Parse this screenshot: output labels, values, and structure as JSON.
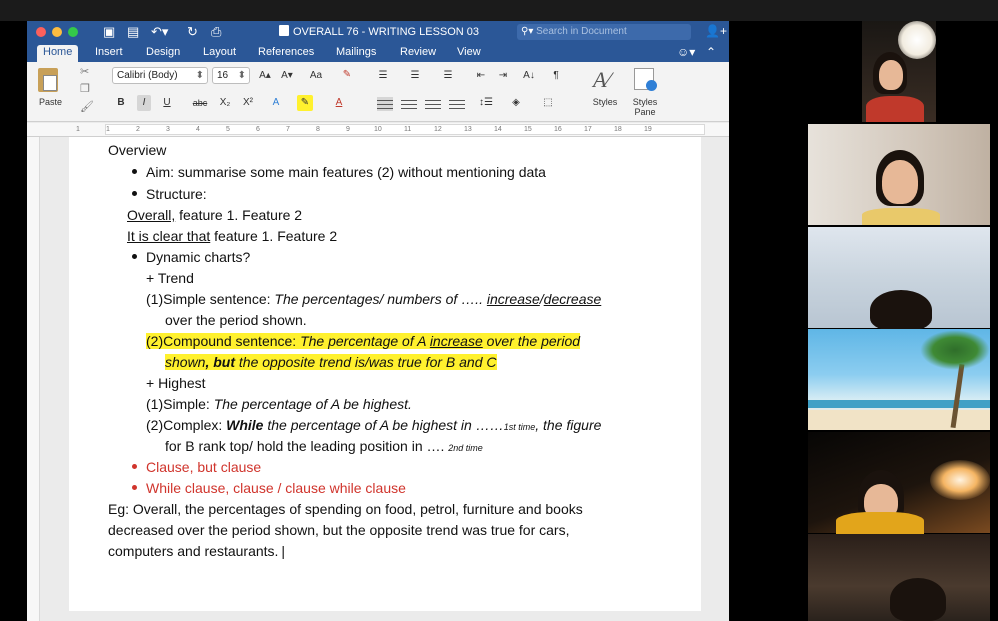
{
  "window": {
    "title": "OVERALL 76 - WRITING LESSON 03",
    "search_placeholder": "Search in Document"
  },
  "tabs": [
    {
      "label": "Home"
    },
    {
      "label": "Insert"
    },
    {
      "label": "Design"
    },
    {
      "label": "Layout"
    },
    {
      "label": "References"
    },
    {
      "label": "Mailings"
    },
    {
      "label": "Review"
    },
    {
      "label": "View"
    }
  ],
  "ribbon": {
    "paste_label": "Paste",
    "font_name": "Calibri (Body)",
    "font_size": "16",
    "bold": "B",
    "italic": "I",
    "underline": "U",
    "strikethrough": "abc",
    "subscript": "X₂",
    "superscript": "X²",
    "grow_font": "A▴",
    "shrink_font": "A▾",
    "change_case": "Aa",
    "font_color": "A",
    "highlight": "✎",
    "effects": "A",
    "sort": "A↓",
    "pilcrow": "¶",
    "styles_label": "Styles",
    "styles_pane_label": "Styles Pane"
  },
  "ruler": {
    "numbers": [
      "1",
      "1",
      "2",
      "3",
      "4",
      "5",
      "6",
      "7",
      "8",
      "9",
      "10",
      "11",
      "12",
      "13",
      "14",
      "15",
      "16",
      "17",
      "18",
      "19"
    ]
  },
  "document": {
    "heading": "Overview",
    "aim_label": "Aim: summarise some main features (2) without mentioning data",
    "structure_label": "Structure:",
    "overall_prefix": "Overall,",
    "overall_rest": " feature 1. Feature 2",
    "clear_prefix": "It is clear that",
    "clear_rest": " feature 1. Feature 2",
    "dynamic_label": "Dynamic charts?",
    "trend_label": "+ Trend",
    "s1_label": "(1)Simple sentence: ",
    "s1_italic": "The percentages/ numbers of ….. ",
    "s1_increase": "increase",
    "s1_slash": "/",
    "s1_decrease": "decrease",
    "s1_cont": "over the period shown.",
    "s2_label": "(2)Compound sentence: ",
    "s2_italic": "The percentage of A ",
    "s2_increase": "increase",
    "s2_rest": " over the period",
    "s2_cont_a": "shown",
    "s2_cont_but": ", but",
    "s2_cont_b": " the opposite trend is/was true for B and C",
    "highest_label": "+ Highest",
    "h1_label": "(1)Simple: ",
    "h1_italic": "The percentage of A be highest.",
    "h2_label": "(2)Complex: ",
    "h2_while": "While",
    "h2_italic": " the percentage of A be highest in ……",
    "h2_first": "1st time",
    "h2_rest": ", the figure",
    "h2_cont": "for B rank top/ hold the leading position in …. ",
    "h2_second": "2nd time",
    "red1": "Clause, but clause",
    "red2": "While clause, clause / clause while clause",
    "eg1": "Eg: Overall, the percentages of spending on food, petrol, furniture and books",
    "eg2": "decreased over the period shown, but the opposite trend was true for cars,",
    "eg3": "computers and restaurants."
  },
  "participants": [
    {
      "tile": "participant-1"
    },
    {
      "tile": "participant-2"
    },
    {
      "tile": "participant-3"
    },
    {
      "tile": "participant-4"
    },
    {
      "tile": "participant-5"
    },
    {
      "tile": "participant-6"
    }
  ],
  "colors": {
    "word_blue": "#2b5797",
    "highlight": "#fff12e",
    "red_text": "#d0342c"
  }
}
